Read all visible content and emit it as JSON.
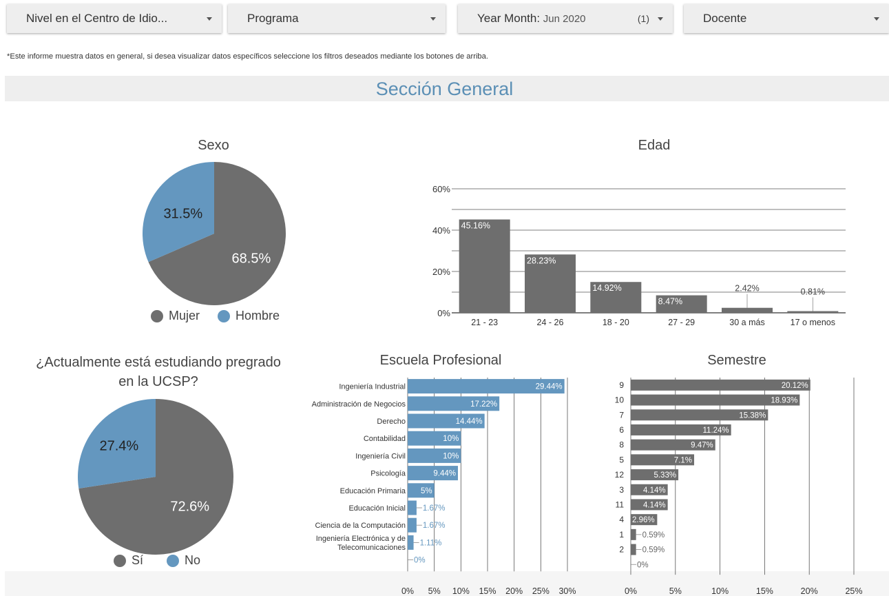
{
  "filters": {
    "nivel": "Nivel en el Centro de Idio...",
    "programa": "Programa",
    "year_month_label": "Year Month",
    "year_month_value": "Jun 2020",
    "year_month_count": "(1)",
    "docente": "Docente"
  },
  "note": "*Este informe muestra datos en general, si desea visualizar datos específicos seleccione los filtros deseados mediante los botones de arriba.",
  "section_title": "Sección General",
  "colors": {
    "gray": "#6e6e6e",
    "blue": "#6497bf",
    "accent_title": "#5b8fb5"
  },
  "chart_data": [
    {
      "id": "sexo",
      "type": "pie",
      "title": "Sexo",
      "categories": [
        "Mujer",
        "Hombre"
      ],
      "values": [
        68.5,
        31.5
      ],
      "labels": [
        "68.5%",
        "31.5%"
      ],
      "colors": [
        "#6e6e6e",
        "#6497bf"
      ],
      "legend": "bottom"
    },
    {
      "id": "edad",
      "type": "bar",
      "title": "Edad",
      "categories": [
        "21 - 23",
        "24 - 26",
        "18 - 20",
        "27 - 29",
        "30 a más",
        "17 o menos"
      ],
      "values": [
        45.16,
        28.23,
        14.92,
        8.47,
        2.42,
        0.81
      ],
      "labels": [
        "45.16%",
        "28.23%",
        "14.92%",
        "8.47%",
        "2.42%",
        "0.81%"
      ],
      "yticks": [
        "0%",
        "20%",
        "40%",
        "60%"
      ],
      "ylim": [
        0,
        60
      ],
      "grid": true
    },
    {
      "id": "pregrado",
      "type": "pie",
      "title": "¿Actualmente está estudiando pregrado en la UCSP?",
      "title_lines": [
        "¿Actualmente está estudiando pregrado",
        "en la UCSP?"
      ],
      "categories": [
        "Sí",
        "No"
      ],
      "values": [
        72.6,
        27.4
      ],
      "labels": [
        "72.6%",
        "27.4%"
      ],
      "colors": [
        "#6e6e6e",
        "#6497bf"
      ],
      "legend": "bottom"
    },
    {
      "id": "escuela",
      "type": "bar",
      "orientation": "horizontal",
      "title": "Escuela Profesional",
      "categories": [
        "Ingeniería Industrial",
        "Administración de Negocios",
        "Derecho",
        "Contabilidad",
        "Ingeniería Civil",
        "Psicología",
        "Educación Primaria",
        "Educación Inicial",
        "Ciencia de la Computación",
        "Ingeniería Electrónica y de Telecomunicaciones",
        ""
      ],
      "category_lines": [
        [
          "Ingeniería Industrial"
        ],
        [
          "Administración de Negocios"
        ],
        [
          "Derecho"
        ],
        [
          "Contabilidad"
        ],
        [
          "Ingeniería Civil"
        ],
        [
          "Psicología"
        ],
        [
          "Educación Primaria"
        ],
        [
          "Educación Inicial"
        ],
        [
          "Ciencia de la Computación"
        ],
        [
          "Ingeniería Electrónica y de",
          "Telecomunicaciones"
        ],
        []
      ],
      "values": [
        29.44,
        17.22,
        14.44,
        10,
        10,
        9.44,
        5,
        1.67,
        1.67,
        1.11,
        0
      ],
      "labels": [
        "29.44%",
        "17.22%",
        "14.44%",
        "10%",
        "10%",
        "9.44%",
        "5%",
        "1.67%",
        "1.67%",
        "1.11%",
        "0%"
      ],
      "xticks": [
        "0%",
        "5%",
        "10%",
        "15%",
        "20%",
        "25%",
        "30%"
      ],
      "xlim": [
        0,
        30
      ],
      "color": "#6497bf"
    },
    {
      "id": "semestre",
      "type": "bar",
      "orientation": "horizontal",
      "title": "Semestre",
      "categories": [
        "9",
        "10",
        "7",
        "6",
        "8",
        "5",
        "12",
        "3",
        "11",
        "4",
        "1",
        "2",
        ""
      ],
      "values": [
        20.12,
        18.93,
        15.38,
        11.24,
        9.47,
        7.1,
        5.33,
        4.14,
        4.14,
        2.96,
        0.59,
        0.59,
        0
      ],
      "labels": [
        "20.12%",
        "18.93%",
        "15.38%",
        "11.24%",
        "9.47%",
        "7.1%",
        "5.33%",
        "4.14%",
        "4.14%",
        "2.96%",
        "0.59%",
        "0.59%",
        "0%"
      ],
      "xticks": [
        "0%",
        "5%",
        "10%",
        "15%",
        "20%",
        "25%"
      ],
      "xlim": [
        0,
        25
      ],
      "color": "#6e6e6e"
    }
  ]
}
